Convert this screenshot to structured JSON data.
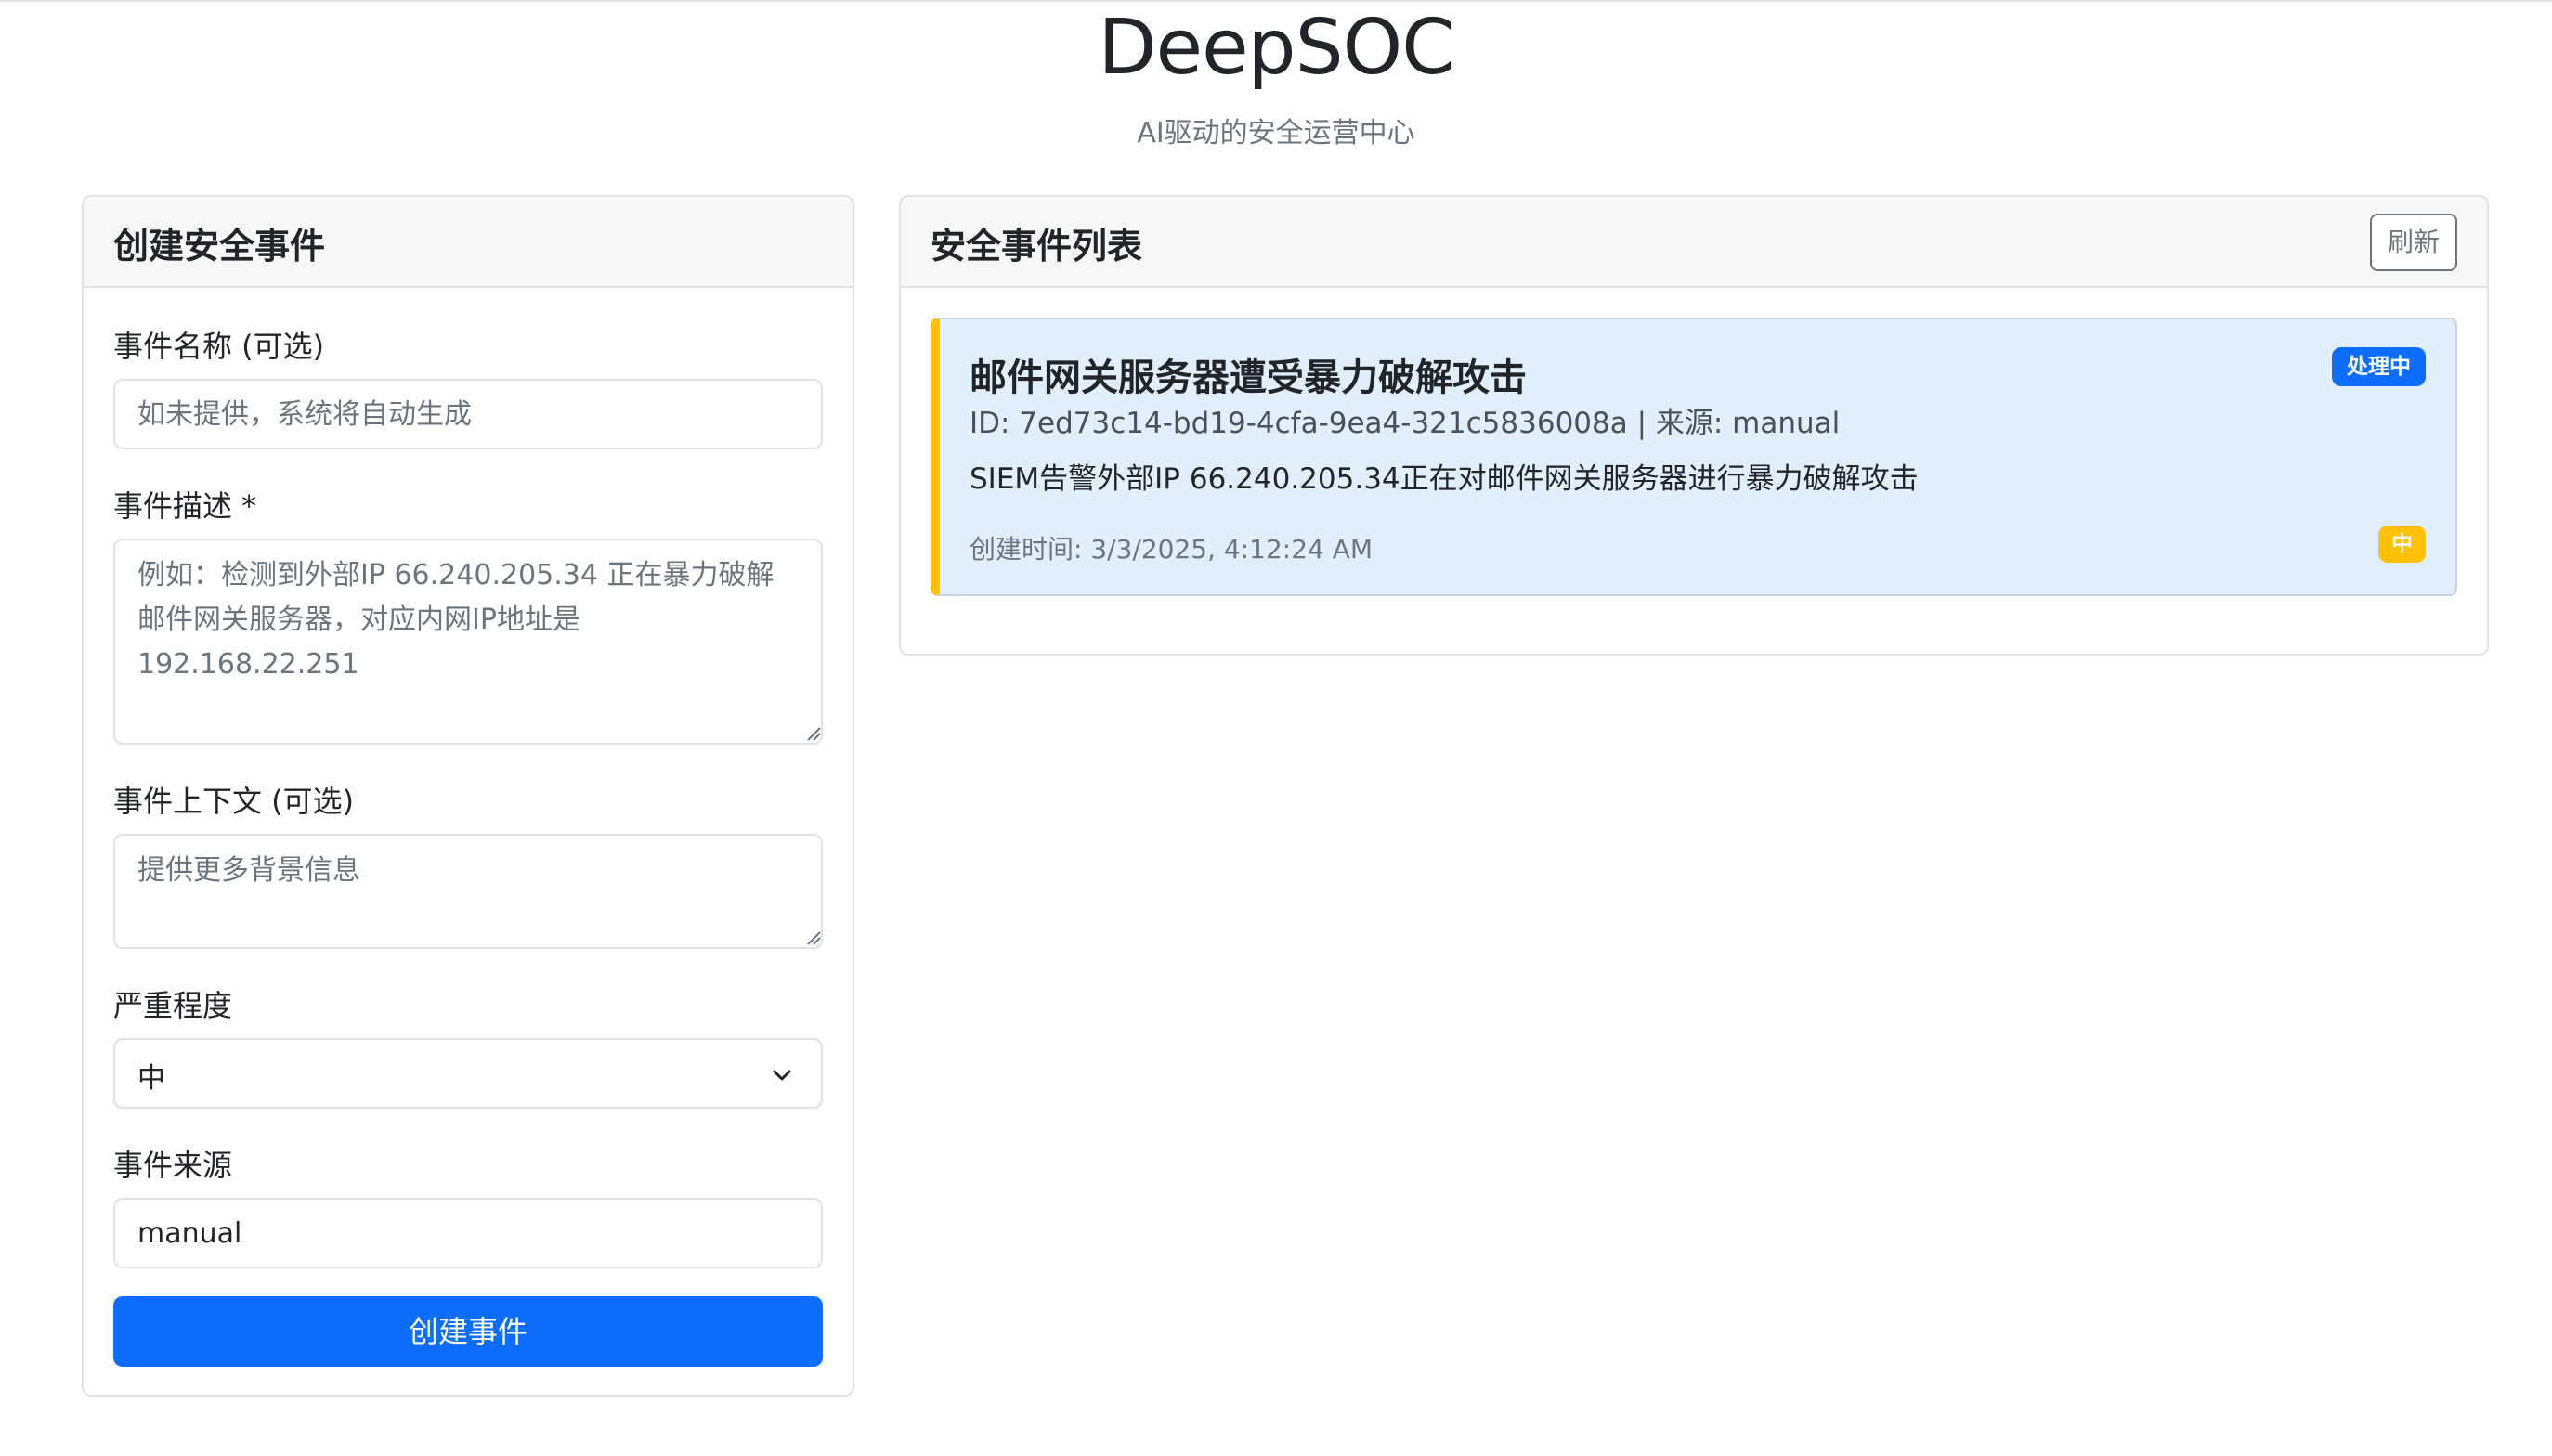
{
  "header": {
    "title": "DeepSOC",
    "subtitle": "AI驱动的安全运营中心"
  },
  "create_form": {
    "card_title": "创建安全事件",
    "name_label": "事件名称 (可选)",
    "name_placeholder": "如未提供，系统将自动生成",
    "description_label": "事件描述 *",
    "description_placeholder": "例如：检测到外部IP 66.240.205.34 正在暴力破解邮件网关服务器，对应内网IP地址是192.168.22.251",
    "context_label": "事件上下文 (可选)",
    "context_placeholder": "提供更多背景信息",
    "severity_label": "严重程度",
    "severity_value": "中",
    "source_label": "事件来源",
    "source_value": "manual",
    "submit_label": "创建事件"
  },
  "incident_list": {
    "card_title": "安全事件列表",
    "refresh_label": "刷新",
    "items": [
      {
        "title": "邮件网关服务器遭受暴力破解攻击",
        "meta": "ID: 7ed73c14-bd19-4cfa-9ea4-321c5836008a | 来源: manual",
        "description": "SIEM告警外部IP 66.240.205.34正在对邮件网关服务器进行暴力破解攻击",
        "created": "创建时间: 3/3/2025, 4:12:24 AM",
        "status": "处理中",
        "severity": "中"
      }
    ]
  },
  "colors": {
    "primary": "#0d6efd",
    "warning": "#ffc107",
    "incident_bg": "#e1eefb"
  }
}
